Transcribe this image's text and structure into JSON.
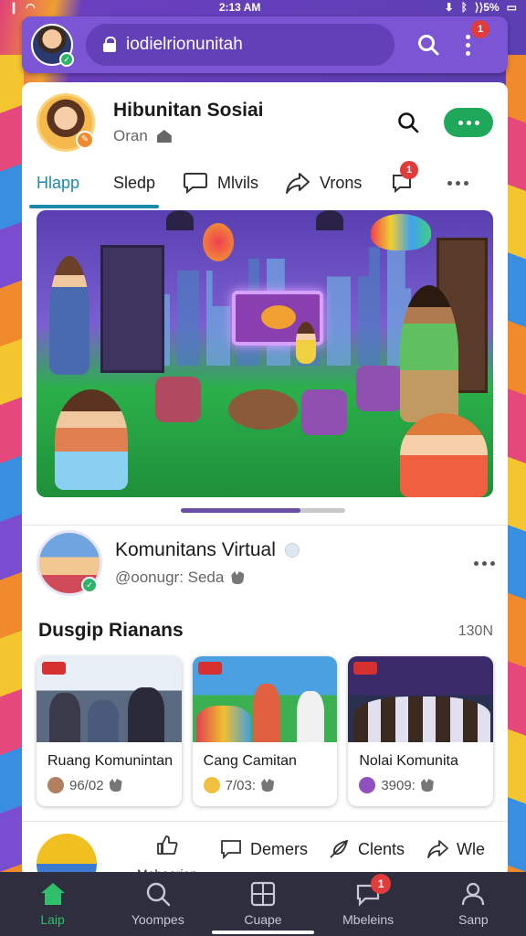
{
  "status_bar": {
    "time": "2:13 AM",
    "left_icons": [
      "notification-icon",
      "wifi-icon"
    ],
    "right_icons": [
      "download-icon",
      "bluetooth-icon",
      "signal-icon",
      "battery-icon"
    ],
    "right_text": "⟩⟩5%"
  },
  "browser": {
    "url": "iodielrionunitah",
    "badge": "1"
  },
  "profile": {
    "name": "Hibunitan Sosiai",
    "subtitle": "Oran"
  },
  "tabs": [
    {
      "label": "Hlapp",
      "active": true
    },
    {
      "label": "Sledp"
    },
    {
      "label": "Mlvils",
      "icon": "comment-icon"
    },
    {
      "label": "Vrons",
      "icon": "share-icon"
    },
    {
      "label": "",
      "icon": "chat-icon",
      "badge": "1"
    },
    {
      "label": "",
      "icon": "more-icon"
    }
  ],
  "hero": {
    "scroll_progress": 0.73
  },
  "community": {
    "name": "Komunitans Virtual",
    "handle": "@oonugr: Seda"
  },
  "section": {
    "title": "Dusgip Rianans",
    "count": "130N",
    "cards": [
      {
        "title": "Ruang Komunintan",
        "stat": "96/02",
        "icon_color": "#b08060"
      },
      {
        "title": "Cang Camitan",
        "stat": "7/03:",
        "icon_color": "#f0c040"
      },
      {
        "title": "Nolai Komunita",
        "stat": "3909:",
        "icon_color": "#9050c0"
      }
    ]
  },
  "actions": {
    "like_label": "Mebaarien",
    "comment_label": "Demers",
    "share_label": "Clents",
    "forward_label": "Wle"
  },
  "bottom_nav": [
    {
      "label": "Laip",
      "icon": "home-icon",
      "active": true
    },
    {
      "label": "Yoompes",
      "icon": "search-icon"
    },
    {
      "label": "Cuape",
      "icon": "grid-icon"
    },
    {
      "label": "Mbeleins",
      "icon": "chat-icon",
      "badge": "1"
    },
    {
      "label": "Sanp",
      "icon": "profile-icon"
    }
  ],
  "colors": {
    "accent": "#7b55d3",
    "green": "#1fa85a",
    "tab_active": "#1c8aa8",
    "badge": "#e23b3b",
    "nav_bg": "#2e2e3e"
  }
}
